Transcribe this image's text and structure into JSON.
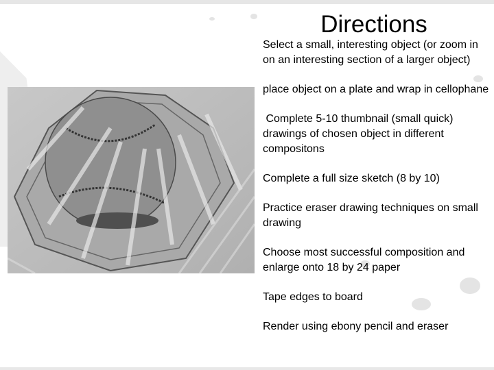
{
  "slide": {
    "title": "Directions",
    "image": {
      "subject": "pencil drawing of a baseball on a plate wrapped in cellophane",
      "icon": "sketch-image"
    },
    "steps": [
      "Select a small, interesting object (or zoom in on an interesting section of a larger object)",
      "place object on a plate and wrap in cellophane",
      " Complete 5-10 thumbnail (small quick) drawings of chosen object in different compositons",
      "Complete a full size sketch (8 by 10)",
      "Practice eraser drawing techniques on small drawing",
      "Choose most successful composition and enlarge onto 18 by 24 paper",
      "Tape edges to board",
      "Render using ebony pencil and eraser"
    ]
  },
  "colors": {
    "background": "#ffffff",
    "text": "#000000",
    "sketch_paper": "#bdbdbd",
    "graphite": "#555555"
  }
}
